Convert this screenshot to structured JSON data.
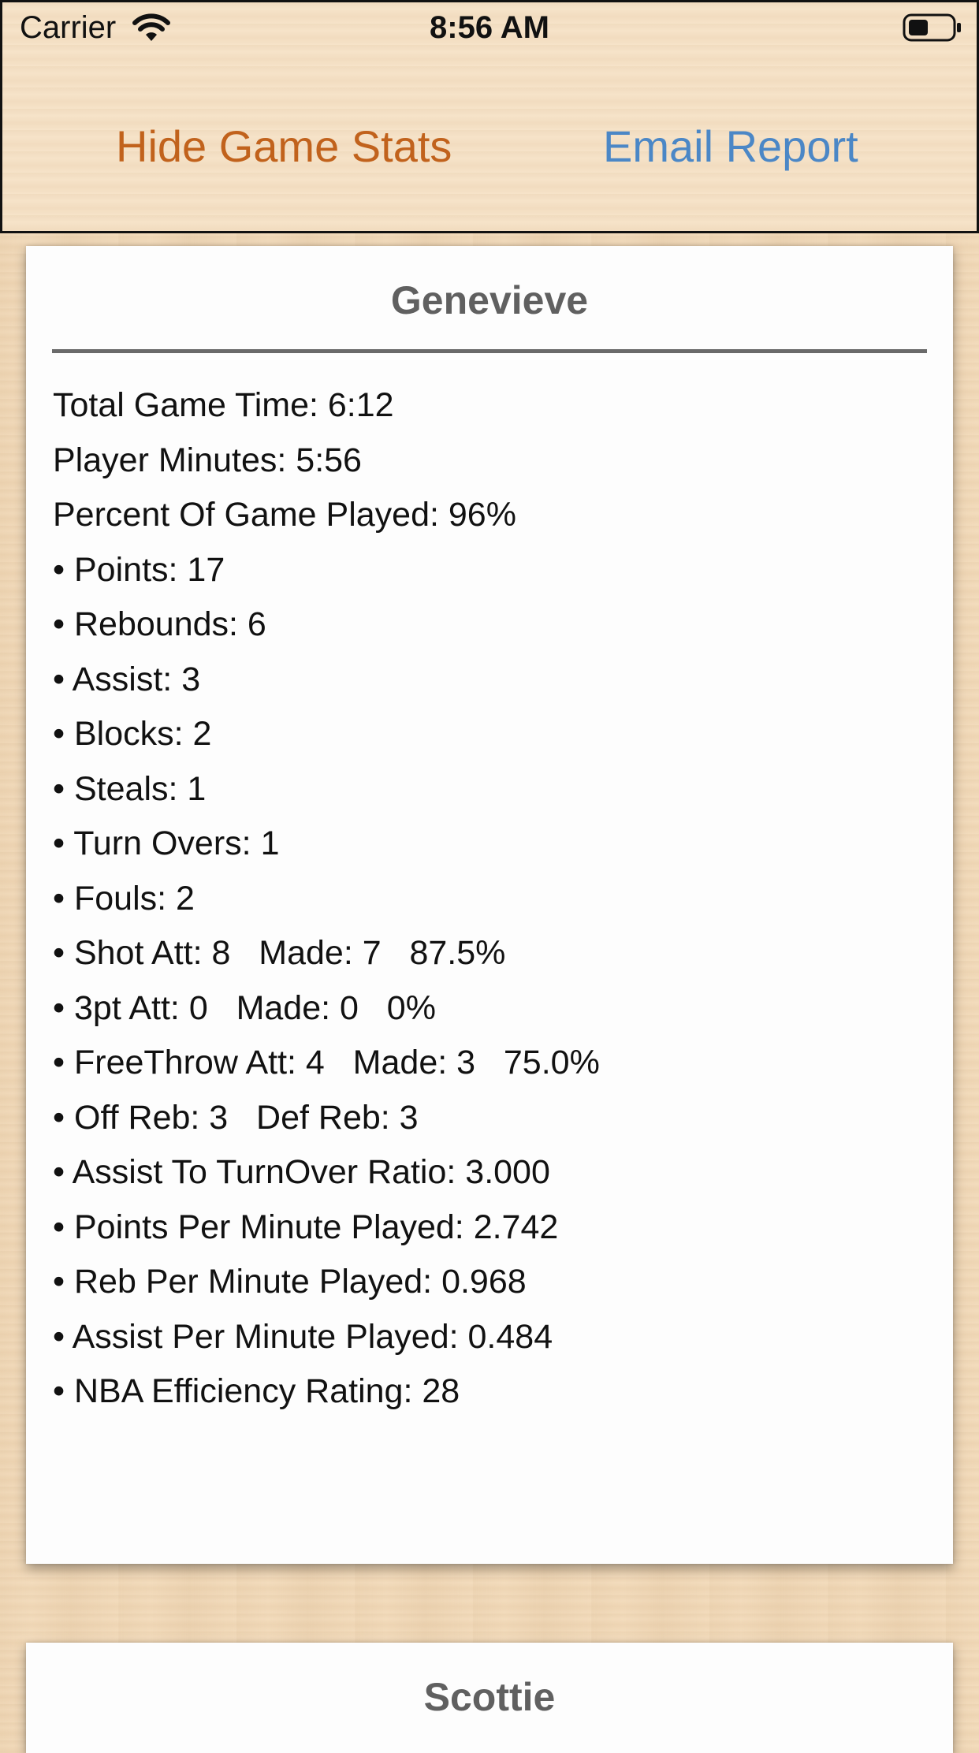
{
  "status_bar": {
    "carrier": "Carrier",
    "time": "8:56 AM",
    "icons": [
      "wifi-icon",
      "battery-icon"
    ]
  },
  "toolbar": {
    "hide_stats_label": "Hide Game Stats",
    "email_report_label": "Email Report"
  },
  "colors": {
    "hide_button": "#c1621c",
    "email_button": "#4b87c6",
    "player_name": "#606060"
  },
  "players": [
    {
      "name": "Genevieve",
      "summary": [
        "Total Game Time: 6:12",
        "Player Minutes: 5:56",
        "Percent Of Game Played: 96%"
      ],
      "stats": [
        "• Points: 17",
        "• Rebounds: 6",
        "• Assist: 3",
        "• Blocks: 2",
        "• Steals: 1",
        "• Turn Overs: 1",
        "• Fouls: 2",
        "• Shot Att: 8   Made: 7   87.5%",
        "• 3pt Att: 0   Made: 0   0%",
        "• FreeThrow Att: 4   Made: 3   75.0%",
        "• Off Reb: 3   Def Reb: 3",
        "• Assist To TurnOver Ratio: 3.000",
        "• Points Per Minute Played: 2.742",
        "• Reb Per Minute Played: 0.968",
        "• Assist Per Minute Played: 0.484",
        "• NBA Efficiency Rating: 28"
      ]
    },
    {
      "name": "Scottie"
    }
  ]
}
